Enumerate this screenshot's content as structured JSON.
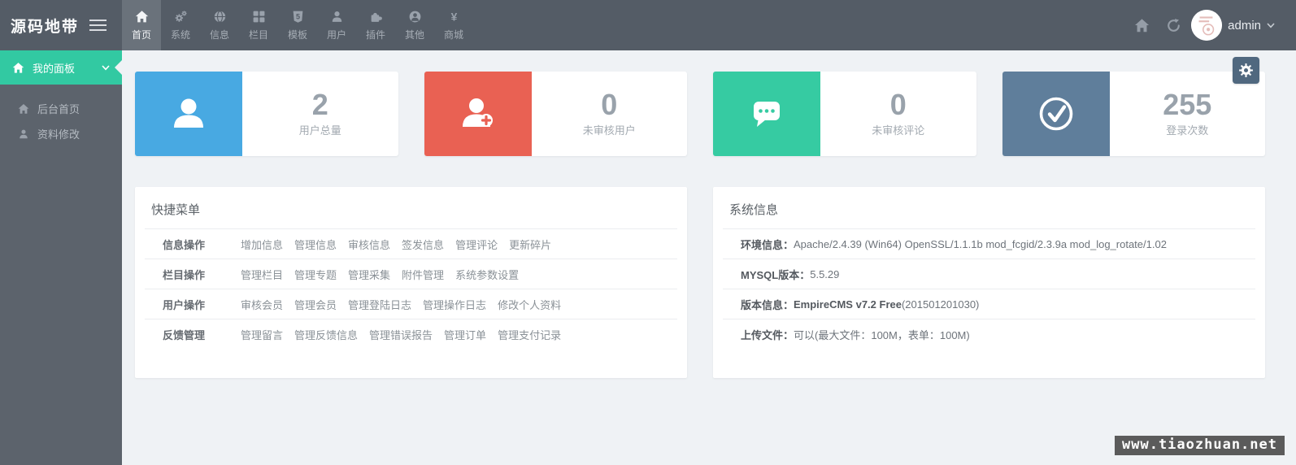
{
  "brand": {
    "logo": "源码地带"
  },
  "navbar": {
    "tabs": [
      {
        "icon": "home-icon",
        "label": "首页",
        "active": true
      },
      {
        "icon": "gears-icon",
        "label": "系统",
        "active": false
      },
      {
        "icon": "globe-icon",
        "label": "信息",
        "active": false
      },
      {
        "icon": "grid-icon",
        "label": "栏目",
        "active": false
      },
      {
        "icon": "html5-icon",
        "label": "模板",
        "active": false
      },
      {
        "icon": "user-icon",
        "label": "用户",
        "active": false
      },
      {
        "icon": "puzzle-icon",
        "label": "插件",
        "active": false
      },
      {
        "icon": "user-circle-icon",
        "label": "其他",
        "active": false
      },
      {
        "icon": "yen-icon",
        "label": "商城",
        "active": false
      }
    ],
    "right": {
      "username": "admin"
    }
  },
  "sidebar": {
    "panel_title": "我的面板",
    "items": [
      {
        "icon": "home-icon",
        "label": "后台首页"
      },
      {
        "icon": "user-icon",
        "label": "资料修改"
      }
    ]
  },
  "stats": {
    "cards": [
      {
        "icon": "user-icon",
        "color": "#48A9E2",
        "value": "2",
        "label": "用户总量"
      },
      {
        "icon": "user-plus-icon",
        "color": "#E96153",
        "value": "0",
        "label": "未审核用户"
      },
      {
        "icon": "comment-icon",
        "color": "#36CBA2",
        "value": "0",
        "label": "未审核评论"
      },
      {
        "icon": "check-circle-icon",
        "color": "#5F7E9B",
        "value": "255",
        "label": "登录次数"
      }
    ]
  },
  "quick_menu": {
    "title": "快捷菜单",
    "rows": [
      {
        "label": "信息操作",
        "links": [
          "增加信息",
          "管理信息",
          "审核信息",
          "签发信息",
          "管理评论",
          "更新碎片"
        ]
      },
      {
        "label": "栏目操作",
        "links": [
          "管理栏目",
          "管理专题",
          "管理采集",
          "附件管理",
          "系统参数设置"
        ]
      },
      {
        "label": "用户操作",
        "links": [
          "审核会员",
          "管理会员",
          "管理登陆日志",
          "管理操作日志",
          "修改个人资料"
        ]
      },
      {
        "label": "反馈管理",
        "links": [
          "管理留言",
          "管理反馈信息",
          "管理错误报告",
          "管理订单",
          "管理支付记录"
        ]
      }
    ]
  },
  "system_info": {
    "title": "系统信息",
    "rows": [
      {
        "label": "环境信息：",
        "bold_value": "",
        "value": "Apache/2.4.39 (Win64) OpenSSL/1.1.1b mod_fcgid/2.3.9a mod_log_rotate/1.02"
      },
      {
        "label": "MYSQL版本：",
        "bold_value": "",
        "value": "5.5.29"
      },
      {
        "label": "版本信息：",
        "bold_value": "EmpireCMS v7.2 Free",
        "value": " (201501201030)"
      },
      {
        "label": "上传文件：",
        "bold_value": "",
        "value": "可以(最大文件：100M，表单：100M)"
      }
    ]
  },
  "watermark": "www.tiaozhuan.net",
  "colors": {
    "navbar_bg": "#545C66",
    "navbar_active_bg": "#6A727B",
    "sidebar_bg": "#5C636C",
    "accent_green": "#32C9A2",
    "card_blue": "#48A9E2",
    "card_red": "#E96153",
    "card_green": "#36CBA2",
    "card_slate": "#5F7E9B",
    "content_bg": "#EFF2F5",
    "settings_btn_bg": "#50687F",
    "watermark_bg": "#5B5B5B"
  }
}
